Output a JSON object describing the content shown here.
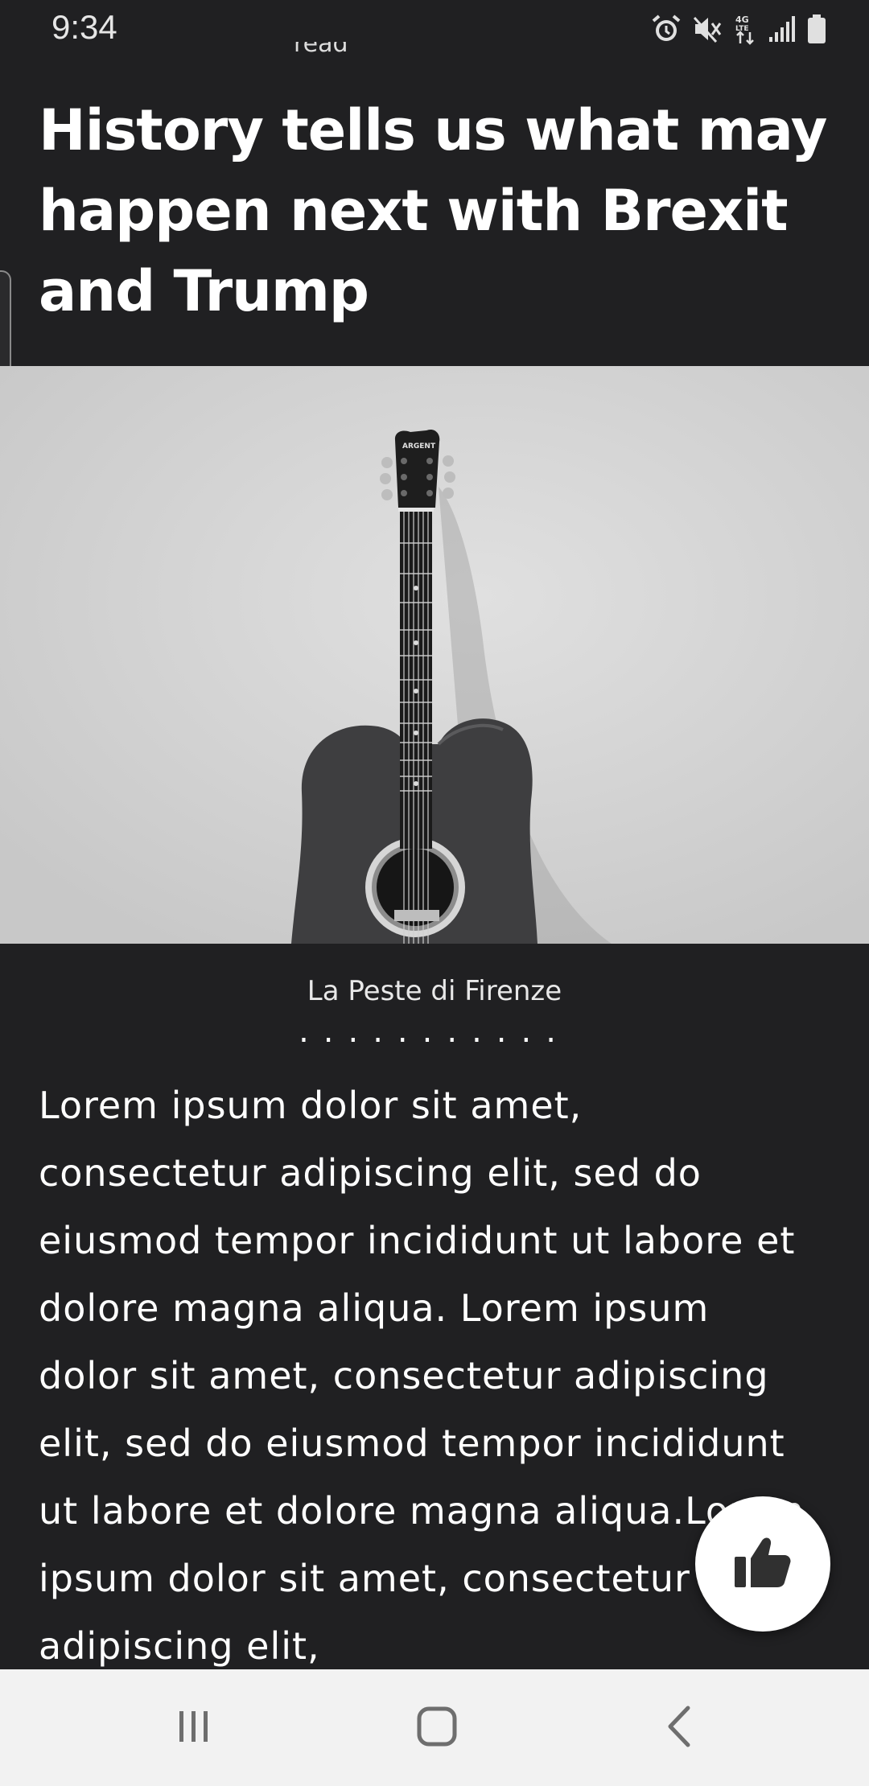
{
  "status_bar": {
    "time": "9:34",
    "icons": [
      "alarm-icon",
      "mute-icon",
      "lte-data-icon",
      "signal-icon",
      "battery-icon"
    ]
  },
  "article": {
    "peek_text": "read",
    "headline": "History tells us what may happen next with Brexit and Trump",
    "image_caption": "La Peste di Firenze",
    "divider": "...........",
    "body": "Lorem ipsum dolor sit amet, consectetur adipiscing elit, sed do eiusmod tempor incididunt ut labore et dolore magna aliqua. Lorem ipsum dolor sit amet, consectetur adipiscing elit, sed do eiusmod tempor incididunt ut labore et dolore magna aliqua.Lorem ipsum dolor sit amet, consectetur adipiscing elit,"
  },
  "like_button": {
    "icon": "thumbs-up-icon"
  },
  "nav_bar": {
    "buttons": [
      "recents-icon",
      "home-icon",
      "back-icon"
    ]
  },
  "colors": {
    "background": "#202022",
    "text": "#ffffff",
    "nav_bar": "#f2f2f2",
    "fab": "#ffffff"
  }
}
